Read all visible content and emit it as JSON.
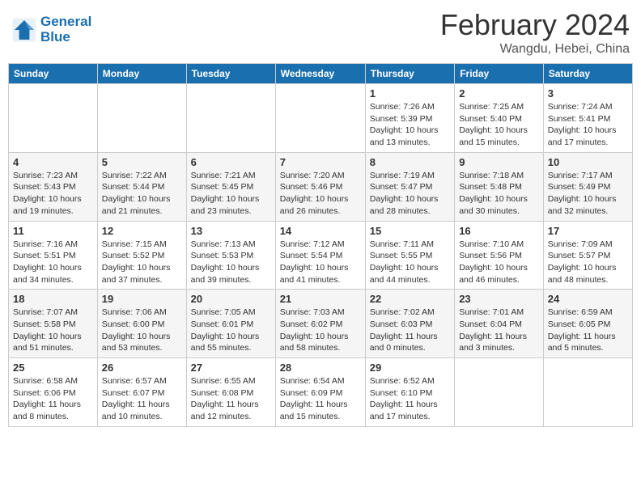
{
  "header": {
    "logo_line1": "General",
    "logo_line2": "Blue",
    "month": "February 2024",
    "location": "Wangdu, Hebei, China"
  },
  "days_of_week": [
    "Sunday",
    "Monday",
    "Tuesday",
    "Wednesday",
    "Thursday",
    "Friday",
    "Saturday"
  ],
  "weeks": [
    [
      {
        "day": "",
        "info": ""
      },
      {
        "day": "",
        "info": ""
      },
      {
        "day": "",
        "info": ""
      },
      {
        "day": "",
        "info": ""
      },
      {
        "day": "1",
        "info": "Sunrise: 7:26 AM\nSunset: 5:39 PM\nDaylight: 10 hours\nand 13 minutes."
      },
      {
        "day": "2",
        "info": "Sunrise: 7:25 AM\nSunset: 5:40 PM\nDaylight: 10 hours\nand 15 minutes."
      },
      {
        "day": "3",
        "info": "Sunrise: 7:24 AM\nSunset: 5:41 PM\nDaylight: 10 hours\nand 17 minutes."
      }
    ],
    [
      {
        "day": "4",
        "info": "Sunrise: 7:23 AM\nSunset: 5:43 PM\nDaylight: 10 hours\nand 19 minutes."
      },
      {
        "day": "5",
        "info": "Sunrise: 7:22 AM\nSunset: 5:44 PM\nDaylight: 10 hours\nand 21 minutes."
      },
      {
        "day": "6",
        "info": "Sunrise: 7:21 AM\nSunset: 5:45 PM\nDaylight: 10 hours\nand 23 minutes."
      },
      {
        "day": "7",
        "info": "Sunrise: 7:20 AM\nSunset: 5:46 PM\nDaylight: 10 hours\nand 26 minutes."
      },
      {
        "day": "8",
        "info": "Sunrise: 7:19 AM\nSunset: 5:47 PM\nDaylight: 10 hours\nand 28 minutes."
      },
      {
        "day": "9",
        "info": "Sunrise: 7:18 AM\nSunset: 5:48 PM\nDaylight: 10 hours\nand 30 minutes."
      },
      {
        "day": "10",
        "info": "Sunrise: 7:17 AM\nSunset: 5:49 PM\nDaylight: 10 hours\nand 32 minutes."
      }
    ],
    [
      {
        "day": "11",
        "info": "Sunrise: 7:16 AM\nSunset: 5:51 PM\nDaylight: 10 hours\nand 34 minutes."
      },
      {
        "day": "12",
        "info": "Sunrise: 7:15 AM\nSunset: 5:52 PM\nDaylight: 10 hours\nand 37 minutes."
      },
      {
        "day": "13",
        "info": "Sunrise: 7:13 AM\nSunset: 5:53 PM\nDaylight: 10 hours\nand 39 minutes."
      },
      {
        "day": "14",
        "info": "Sunrise: 7:12 AM\nSunset: 5:54 PM\nDaylight: 10 hours\nand 41 minutes."
      },
      {
        "day": "15",
        "info": "Sunrise: 7:11 AM\nSunset: 5:55 PM\nDaylight: 10 hours\nand 44 minutes."
      },
      {
        "day": "16",
        "info": "Sunrise: 7:10 AM\nSunset: 5:56 PM\nDaylight: 10 hours\nand 46 minutes."
      },
      {
        "day": "17",
        "info": "Sunrise: 7:09 AM\nSunset: 5:57 PM\nDaylight: 10 hours\nand 48 minutes."
      }
    ],
    [
      {
        "day": "18",
        "info": "Sunrise: 7:07 AM\nSunset: 5:58 PM\nDaylight: 10 hours\nand 51 minutes."
      },
      {
        "day": "19",
        "info": "Sunrise: 7:06 AM\nSunset: 6:00 PM\nDaylight: 10 hours\nand 53 minutes."
      },
      {
        "day": "20",
        "info": "Sunrise: 7:05 AM\nSunset: 6:01 PM\nDaylight: 10 hours\nand 55 minutes."
      },
      {
        "day": "21",
        "info": "Sunrise: 7:03 AM\nSunset: 6:02 PM\nDaylight: 10 hours\nand 58 minutes."
      },
      {
        "day": "22",
        "info": "Sunrise: 7:02 AM\nSunset: 6:03 PM\nDaylight: 11 hours\nand 0 minutes."
      },
      {
        "day": "23",
        "info": "Sunrise: 7:01 AM\nSunset: 6:04 PM\nDaylight: 11 hours\nand 3 minutes."
      },
      {
        "day": "24",
        "info": "Sunrise: 6:59 AM\nSunset: 6:05 PM\nDaylight: 11 hours\nand 5 minutes."
      }
    ],
    [
      {
        "day": "25",
        "info": "Sunrise: 6:58 AM\nSunset: 6:06 PM\nDaylight: 11 hours\nand 8 minutes."
      },
      {
        "day": "26",
        "info": "Sunrise: 6:57 AM\nSunset: 6:07 PM\nDaylight: 11 hours\nand 10 minutes."
      },
      {
        "day": "27",
        "info": "Sunrise: 6:55 AM\nSunset: 6:08 PM\nDaylight: 11 hours\nand 12 minutes."
      },
      {
        "day": "28",
        "info": "Sunrise: 6:54 AM\nSunset: 6:09 PM\nDaylight: 11 hours\nand 15 minutes."
      },
      {
        "day": "29",
        "info": "Sunrise: 6:52 AM\nSunset: 6:10 PM\nDaylight: 11 hours\nand 17 minutes."
      },
      {
        "day": "",
        "info": ""
      },
      {
        "day": "",
        "info": ""
      }
    ]
  ]
}
